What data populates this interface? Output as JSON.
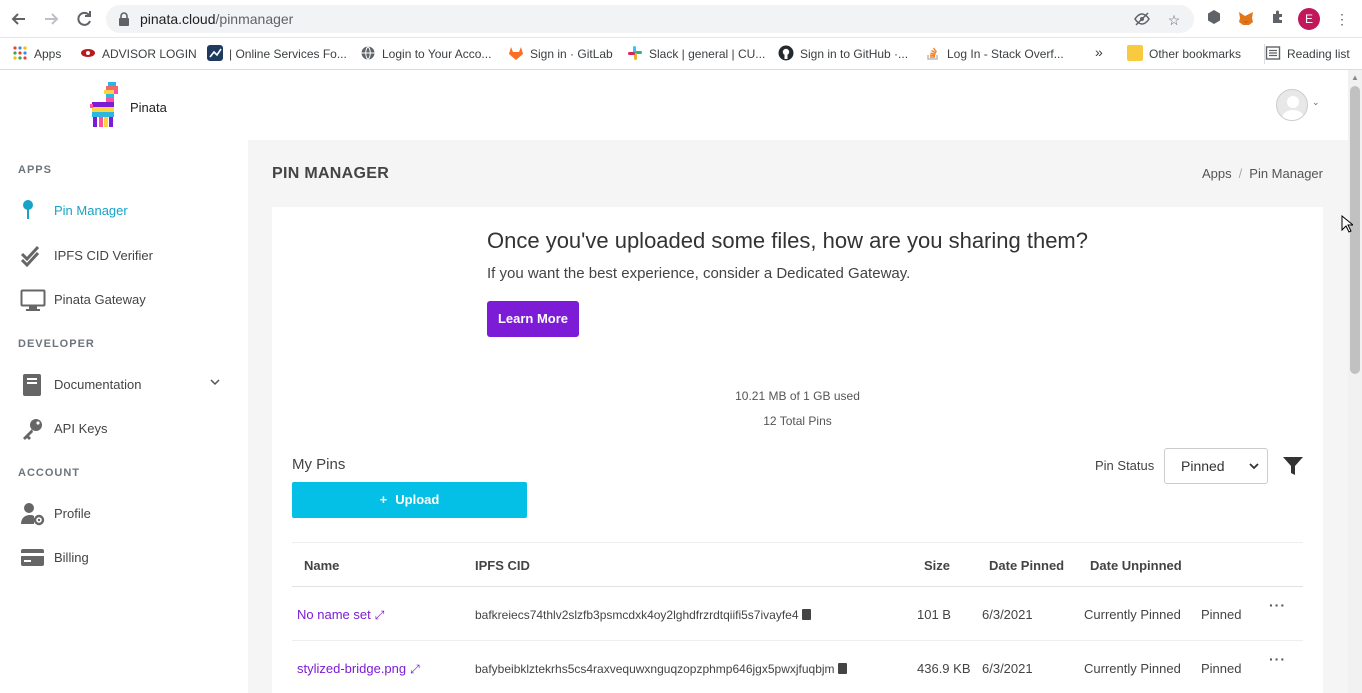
{
  "browser": {
    "url_host": "pinata.cloud",
    "url_path": "/pinmanager",
    "profile_initial": "E",
    "bookmarks": [
      {
        "label": "Apps",
        "icon": "apps-grid-icon"
      },
      {
        "label": "ADVISOR LOGIN",
        "icon": "eye-icon"
      },
      {
        "label": "| Online Services Fo...",
        "icon": "chart-icon"
      },
      {
        "label": "Login to Your Acco...",
        "icon": "globe-icon"
      },
      {
        "label": "Sign in · GitLab",
        "icon": "gitlab-icon"
      },
      {
        "label": "Slack | general | CU...",
        "icon": "slack-icon"
      },
      {
        "label": "Sign in to GitHub ·...",
        "icon": "github-icon"
      },
      {
        "label": "Log In - Stack Overf...",
        "icon": "stackoverflow-icon"
      }
    ],
    "more_bookmarks": "»",
    "other_bookmarks": "Other bookmarks",
    "reading_list": "Reading list"
  },
  "header": {
    "brand": "Pinata"
  },
  "sidebar": {
    "sections": [
      {
        "title": "APPS"
      },
      {
        "title": "DEVELOPER"
      },
      {
        "title": "ACCOUNT"
      }
    ],
    "items": [
      {
        "label": "Pin Manager",
        "icon": "pin-icon",
        "active": true
      },
      {
        "label": "IPFS CID Verifier",
        "icon": "double-check-icon"
      },
      {
        "label": "Pinata Gateway",
        "icon": "monitor-icon"
      },
      {
        "label": "Documentation",
        "icon": "book-icon"
      },
      {
        "label": "API Keys",
        "icon": "key-icon"
      },
      {
        "label": "Profile",
        "icon": "user-gear-icon"
      },
      {
        "label": "Billing",
        "icon": "credit-card-icon"
      }
    ]
  },
  "main": {
    "title": "PIN MANAGER",
    "breadcrumb": [
      "Apps",
      "/",
      "Pin Manager"
    ],
    "promo": {
      "title": "Once you've uploaded some files, how are you sharing them?",
      "subtitle": "If you want the best experience, consider a Dedicated Gateway.",
      "button": "Learn More"
    },
    "usage": {
      "storage": "10.21 MB of 1 GB used",
      "total_pins": "12 Total Pins"
    },
    "my_pins_label": "My Pins",
    "upload_label": "Upload",
    "pin_status_label": "Pin Status",
    "pin_status_value": "Pinned",
    "table": {
      "columns": [
        "Name",
        "IPFS CID",
        "Size",
        "Date Pinned",
        "Date Unpinned"
      ],
      "rows": [
        {
          "name": "No name set",
          "cid": "bafkreiecs74thlv2slzfb3psmcdxk4oy2lghdfrzrdtqiifi5s7ivayfe4",
          "size": "101 B",
          "date_pinned": "6/3/2021",
          "date_unpinned": "Currently Pinned",
          "status": "Pinned"
        },
        {
          "name": "stylized-bridge.png",
          "cid": "bafybeibklztekrhs5cs4raxvequwxnguqzopzphmp646jgx5pwxjfuqbjm",
          "size": "436.9 KB",
          "date_pinned": "6/3/2021",
          "date_unpinned": "Currently Pinned",
          "status": "Pinned"
        }
      ],
      "row_menu": "···"
    }
  },
  "colors": {
    "accent_purple": "#7c1cd6",
    "upload_cyan": "#05c0e6",
    "active_nav": "#17a2c7"
  }
}
